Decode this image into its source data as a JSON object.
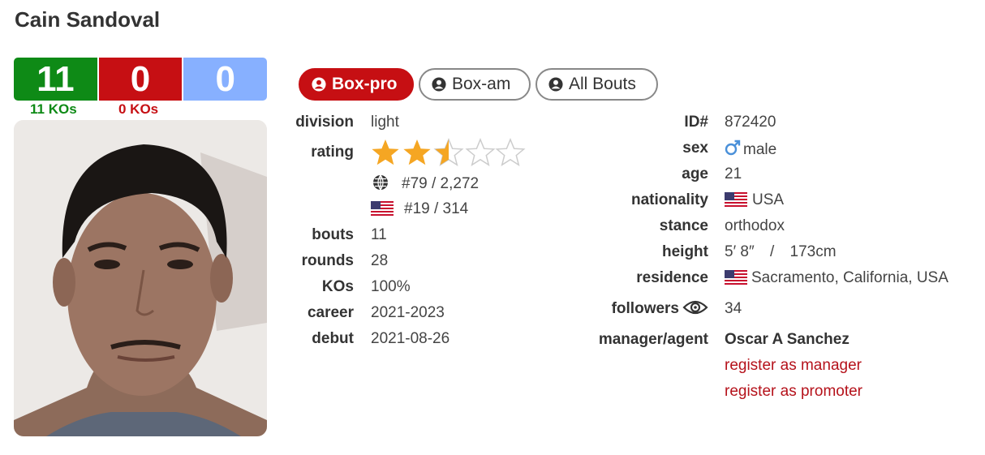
{
  "boxer": {
    "name": "Cain Sandoval"
  },
  "record": {
    "wins": "11",
    "losses": "0",
    "draws": "0",
    "win_kos": "11 KOs",
    "loss_kos": "0 KOs"
  },
  "tabs": [
    {
      "label": "Box-pro",
      "active": true
    },
    {
      "label": "Box-am",
      "active": false
    },
    {
      "label": "All Bouts",
      "active": false
    }
  ],
  "left_info": {
    "division_label": "division",
    "division": "light",
    "rating_label": "rating",
    "rating_stars": 2.5,
    "rating_max": 5,
    "world_rank": "#79 / 2,272",
    "country_rank": "#19 / 314",
    "bouts_label": "bouts",
    "bouts": "11",
    "rounds_label": "rounds",
    "rounds": "28",
    "kos_label": "KOs",
    "kos": "100%",
    "career_label": "career",
    "career": "2021-2023",
    "debut_label": "debut",
    "debut": "2021-08-26"
  },
  "right_info": {
    "id_label": "ID#",
    "id": "872420",
    "sex_label": "sex",
    "sex": "male",
    "age_label": "age",
    "age": "21",
    "nationality_label": "nationality",
    "nationality": "USA",
    "stance_label": "stance",
    "stance": "orthodox",
    "height_label": "height",
    "height_imperial": "5′ 8″",
    "height_sep": "/",
    "height_metric": "173cm",
    "residence_label": "residence",
    "residence": "Sacramento, California, USA",
    "followers_label": "followers",
    "followers": "34",
    "manager_label": "manager/agent",
    "manager": "Oscar A Sanchez",
    "register_manager": "register as manager",
    "register_promoter": "register as promoter"
  },
  "colors": {
    "win": "#0e8a16",
    "loss": "#c60f13",
    "draw": "#87b0ff",
    "star": "#f5a623",
    "link": "#b5121b"
  }
}
